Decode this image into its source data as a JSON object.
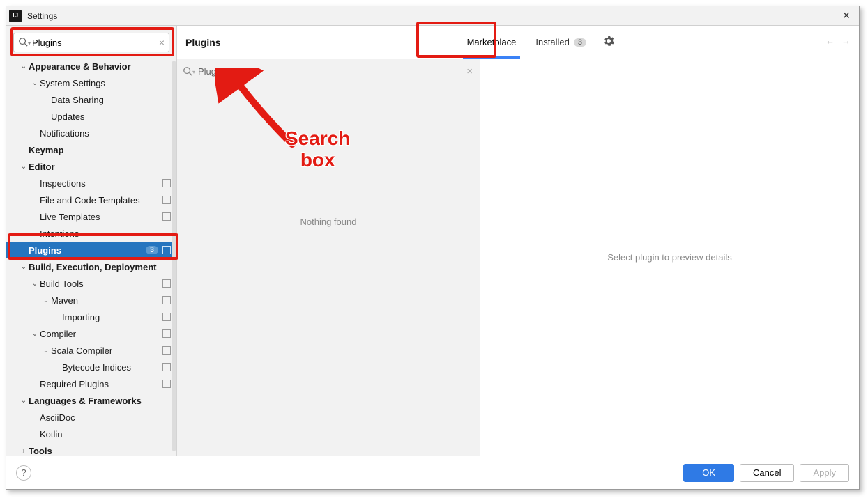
{
  "window": {
    "title": "Settings"
  },
  "sidebar": {
    "search_value": "Plugins",
    "items": [
      {
        "label": "Appearance & Behavior",
        "depth": 0,
        "exp": true,
        "bold": true
      },
      {
        "label": "System Settings",
        "depth": 1,
        "exp": true
      },
      {
        "label": "Data Sharing",
        "depth": 2
      },
      {
        "label": "Updates",
        "depth": 2
      },
      {
        "label": "Notifications",
        "depth": 1
      },
      {
        "label": "Keymap",
        "depth": 0,
        "bold": true,
        "noarrow": true
      },
      {
        "label": "Editor",
        "depth": 0,
        "exp": true,
        "bold": true
      },
      {
        "label": "Inspections",
        "depth": 1,
        "ext": true
      },
      {
        "label": "File and Code Templates",
        "depth": 1,
        "ext": true
      },
      {
        "label": "Live Templates",
        "depth": 1,
        "ext": true
      },
      {
        "label": "Intentions",
        "depth": 1
      },
      {
        "label": "Plugins",
        "depth": 0,
        "selected": true,
        "badge": "3",
        "ext": true,
        "noarrow": true
      },
      {
        "label": "Build, Execution, Deployment",
        "depth": 0,
        "exp": true,
        "bold": true
      },
      {
        "label": "Build Tools",
        "depth": 1,
        "exp": true,
        "ext": true
      },
      {
        "label": "Maven",
        "depth": 2,
        "exp": true,
        "ext": true
      },
      {
        "label": "Importing",
        "depth": 3,
        "ext": true
      },
      {
        "label": "Compiler",
        "depth": 1,
        "exp": true,
        "ext": true
      },
      {
        "label": "Scala Compiler",
        "depth": 2,
        "exp": true,
        "ext": true
      },
      {
        "label": "Bytecode Indices",
        "depth": 3,
        "ext": true
      },
      {
        "label": "Required Plugins",
        "depth": 1,
        "ext": true
      },
      {
        "label": "Languages & Frameworks",
        "depth": 0,
        "exp": true,
        "bold": true
      },
      {
        "label": "AsciiDoc",
        "depth": 1
      },
      {
        "label": "Kotlin",
        "depth": 1
      },
      {
        "label": "Tools",
        "depth": 0,
        "closed": true,
        "bold": true
      }
    ]
  },
  "main": {
    "title": "Plugins",
    "tabs": {
      "marketplace": "Marketplace",
      "installed": "Installed",
      "installed_count": "3"
    },
    "search_value": "Plugints",
    "empty_text": "Nothing found",
    "detail_placeholder": "Select plugin to preview details"
  },
  "footer": {
    "ok": "OK",
    "cancel": "Cancel",
    "apply": "Apply"
  },
  "annotations": {
    "searchbox_label_line1": "Search",
    "searchbox_label_line2": "box"
  }
}
